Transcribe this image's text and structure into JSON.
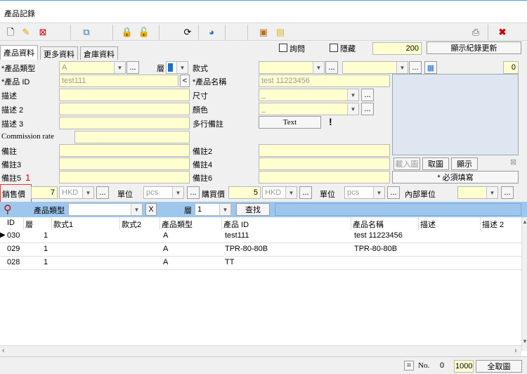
{
  "window": {
    "title": "產品記錄"
  },
  "tabs": [
    "產品資料",
    "更多資料",
    "倉庫資料"
  ],
  "header": {
    "inquiry": "詢問",
    "hidden": "隱藏",
    "record_count": "200",
    "refresh_label": "顯示紀錄更新"
  },
  "labels": {
    "product_type": "*產品類型",
    "layer": "層",
    "product_id": "*產品 ID",
    "desc": "描述",
    "desc2": "描述 2",
    "desc3": "描述 3",
    "commission": "Commission rate",
    "remark": "備註",
    "remark3": "備註3",
    "remark5": "備註5",
    "style": "款式",
    "product_name": "*產品名稱",
    "size": "尺寸",
    "color": "顏色",
    "multiline_remark": "多行備註",
    "remark2": "備註2",
    "remark4": "備註4",
    "remark6": "備註6",
    "sell_price": "銷售價",
    "unit": "單位",
    "buy_price": "購買價",
    "unit2": "單位",
    "inner_unit": "內部單位",
    "required": "* 必須填寫",
    "annotation": "1"
  },
  "values": {
    "product_type": "A",
    "product_id": "test111",
    "product_name": "test 11223456",
    "style_num": "0",
    "size": "_",
    "color": "_",
    "text_btn": "Text",
    "sell_price": "7",
    "sell_currency": "HKD",
    "sell_unit": "pcs",
    "buy_price": "5",
    "buy_currency": "HKD",
    "buy_unit": "pcs"
  },
  "image_buttons": {
    "load": "載入圖",
    "take": "取圖",
    "show": "顯示"
  },
  "search": {
    "product_type_label": "產品類型",
    "clear": "X",
    "layer_label": "層",
    "layer_value": "1",
    "find": "查找"
  },
  "grid": {
    "columns": [
      "ID",
      "層",
      "款式1",
      "款式2",
      "產品類型",
      "產品 ID",
      "產品名稱",
      "描述",
      "描述 2"
    ],
    "rows": [
      [
        "030",
        "1",
        "",
        "",
        "A",
        "test111",
        "test 11223456",
        "",
        ""
      ],
      [
        "029",
        "1",
        "",
        "",
        "A",
        "TPR-80-80B",
        "TPR-80-80B",
        "",
        ""
      ],
      [
        "028",
        "1",
        "",
        "",
        "A",
        "TT",
        "",
        "",
        ""
      ]
    ]
  },
  "footer": {
    "eq": "=",
    "no_label": "No.",
    "no_value": "0",
    "page_size": "1000",
    "take_all": "全取圖"
  }
}
